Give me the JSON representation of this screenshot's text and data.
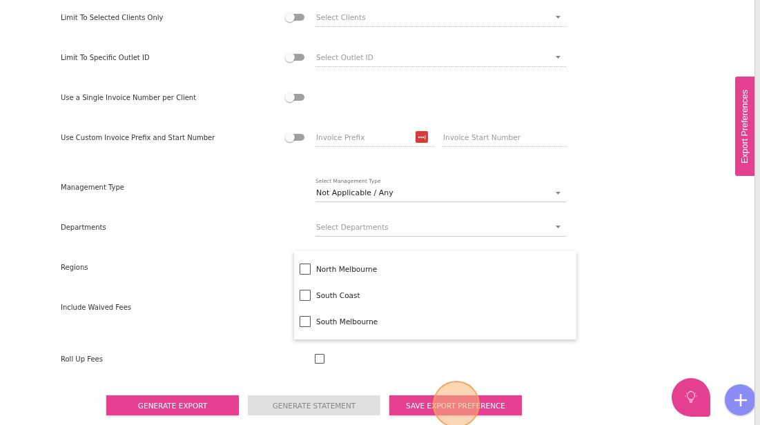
{
  "settings": [
    {
      "kind": "toggle-select",
      "label": "Limit To Selected Clients Only",
      "on": false,
      "placeholder": "Select Clients"
    },
    {
      "kind": "toggle-select",
      "label": "Limit To Specific Outlet ID",
      "on": false,
      "placeholder": "Select Outlet ID"
    },
    {
      "kind": "toggle",
      "label": "Use a Single Invoice Number per Client",
      "on": false
    },
    {
      "kind": "toggle-fields",
      "label": "Use Custom Invoice Prefix and Start Number",
      "on": false,
      "fields": [
        {
          "placeholder": "Invoice Prefix"
        },
        {
          "placeholder": "Invoice Start Number"
        }
      ]
    },
    {
      "kind": "select",
      "label": "Management Type",
      "floating_label": "Select Management Type",
      "value": "Not Applicable / Any"
    },
    {
      "kind": "select",
      "label": "Departments",
      "placeholder": "Select Departments"
    },
    {
      "kind": "covered",
      "label": "Regions"
    },
    {
      "kind": "covered",
      "label": "Include Waived Fees"
    },
    {
      "kind": "checkbox",
      "label": "Roll Up Fees",
      "checked": false
    }
  ],
  "dropdown": {
    "options": [
      {
        "label": "North Melbourne",
        "checked": false
      },
      {
        "label": "South Coast",
        "checked": false
      },
      {
        "label": "South Melbourne",
        "checked": false
      }
    ]
  },
  "buttons": [
    {
      "label": "GENERATE EXPORT",
      "disabled": false
    },
    {
      "label": "GENERATE STATEMENT",
      "disabled": true
    },
    {
      "label": "SAVE EXPORT PREFERENCE",
      "disabled": false
    }
  ],
  "side_tab": {
    "label": "Export Preferences"
  }
}
